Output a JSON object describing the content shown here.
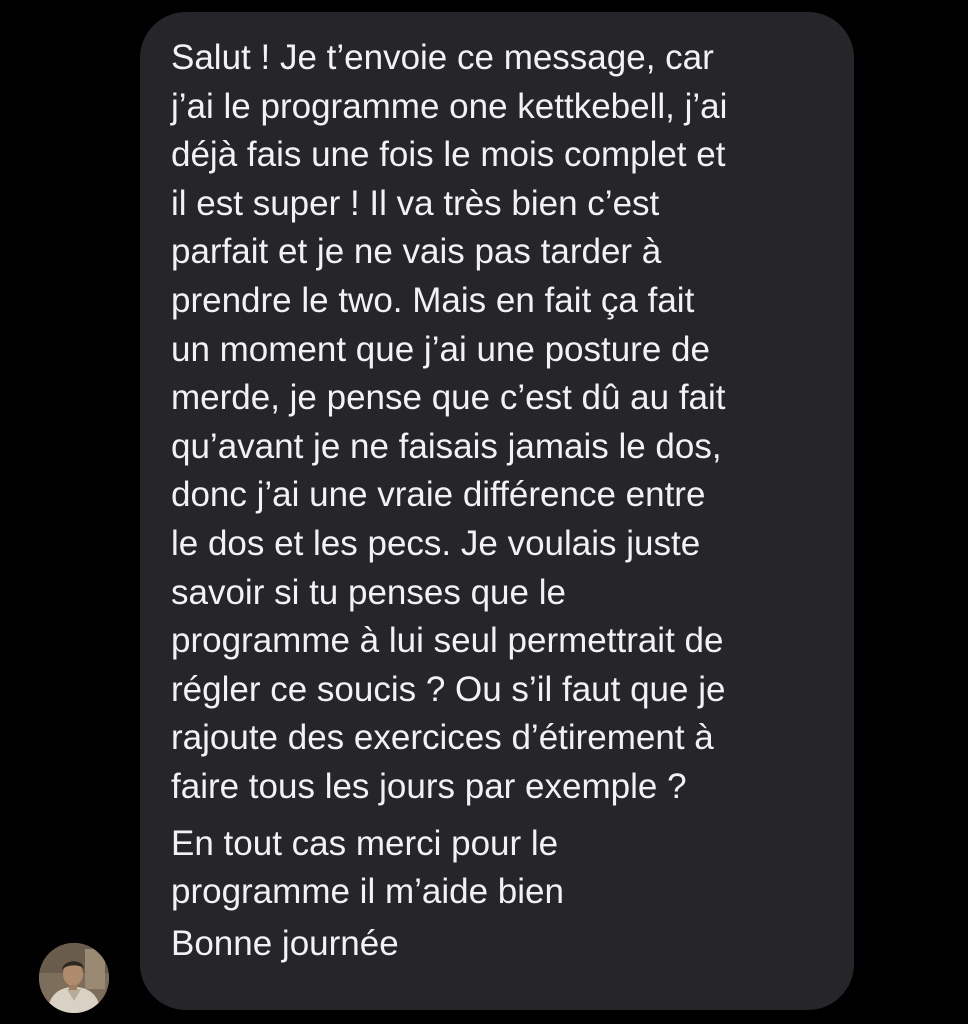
{
  "conversation": {
    "message": {
      "paragraph_1": [
        "Salut ! Je t’envoie ce message, car",
        "j’ai le programme one kettkebell, j’ai",
        "déjà fais une fois le mois complet et",
        "il est super ! Il va très bien c’est",
        "parfait et je ne vais pas tarder à",
        "prendre le two. Mais en fait ça fait",
        "un moment que j’ai une posture de",
        "merde, je pense que c’est dû au fait",
        "qu’avant je ne faisais jamais le dos,",
        "donc j’ai une vraie différence entre",
        "le dos et les pecs. Je voulais juste",
        "savoir si tu penses que le",
        "programme à lui seul permettrait de",
        "régler ce soucis ? Ou s’il faut que je",
        "rajoute des exercices d’étirement à",
        "faire tous les jours par exemple ?"
      ],
      "paragraph_2": [
        "En tout cas merci pour le",
        "programme il m’aide bien"
      ],
      "paragraph_3": [
        "Bonne journée"
      ]
    },
    "sender": {
      "avatar_icon": "profile-photo-icon"
    },
    "colors": {
      "background": "#000000",
      "bubble": "#26262a",
      "text": "#f2f2f4"
    }
  }
}
